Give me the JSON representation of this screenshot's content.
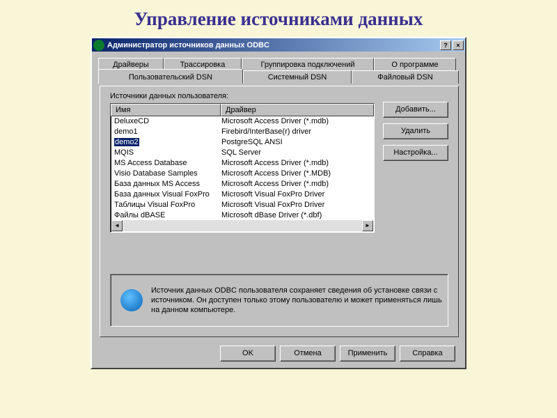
{
  "slide": {
    "title": "Управление источниками данных"
  },
  "window": {
    "title": "Администратор источников данных ODBC",
    "help": "?",
    "close": "×"
  },
  "tabs": {
    "back": [
      "Драйверы",
      "Трассировка",
      "Группировка подключений",
      "О программе"
    ],
    "front": [
      "Пользовательский DSN",
      "Системный DSN",
      "Файловый DSN"
    ]
  },
  "group_label": "Источники данных пользователя:",
  "columns": {
    "name": "Имя",
    "driver": "Драйвер"
  },
  "rows": [
    {
      "name": "DeluxeCD",
      "driver": "Microsoft Access Driver (*.mdb)",
      "selected": false
    },
    {
      "name": "demo1",
      "driver": "Firebird/InterBase(r) driver",
      "selected": false
    },
    {
      "name": "demo2",
      "driver": "PostgreSQL ANSI",
      "selected": true
    },
    {
      "name": "MQIS",
      "driver": "SQL Server",
      "selected": false
    },
    {
      "name": "MS Access Database",
      "driver": "Microsoft Access Driver (*.mdb)",
      "selected": false
    },
    {
      "name": "Visio Database Samples",
      "driver": "Microsoft Access Driver (*.MDB)",
      "selected": false
    },
    {
      "name": "База данных MS Access",
      "driver": "Microsoft Access Driver (*.mdb)",
      "selected": false
    },
    {
      "name": "База данных Visual FoxPro",
      "driver": "Microsoft Visual FoxPro Driver",
      "selected": false
    },
    {
      "name": "Таблицы Visual FoxPro",
      "driver": "Microsoft Visual FoxPro Driver",
      "selected": false
    },
    {
      "name": "Файлы dBASE",
      "driver": "Microsoft dBase Driver (*.dbf)",
      "selected": false
    }
  ],
  "side": {
    "add": "Добавить...",
    "remove": "Удалить",
    "config": "Настройка..."
  },
  "info": "Источник данных ODBC пользователя сохраняет сведения об установке связи с источником.  Он доступен только этому пользователю и может применяться лишь на данном компьютере.",
  "bottom": {
    "ok": "OK",
    "cancel": "Отмена",
    "apply": "Применить",
    "help": "Справка"
  }
}
